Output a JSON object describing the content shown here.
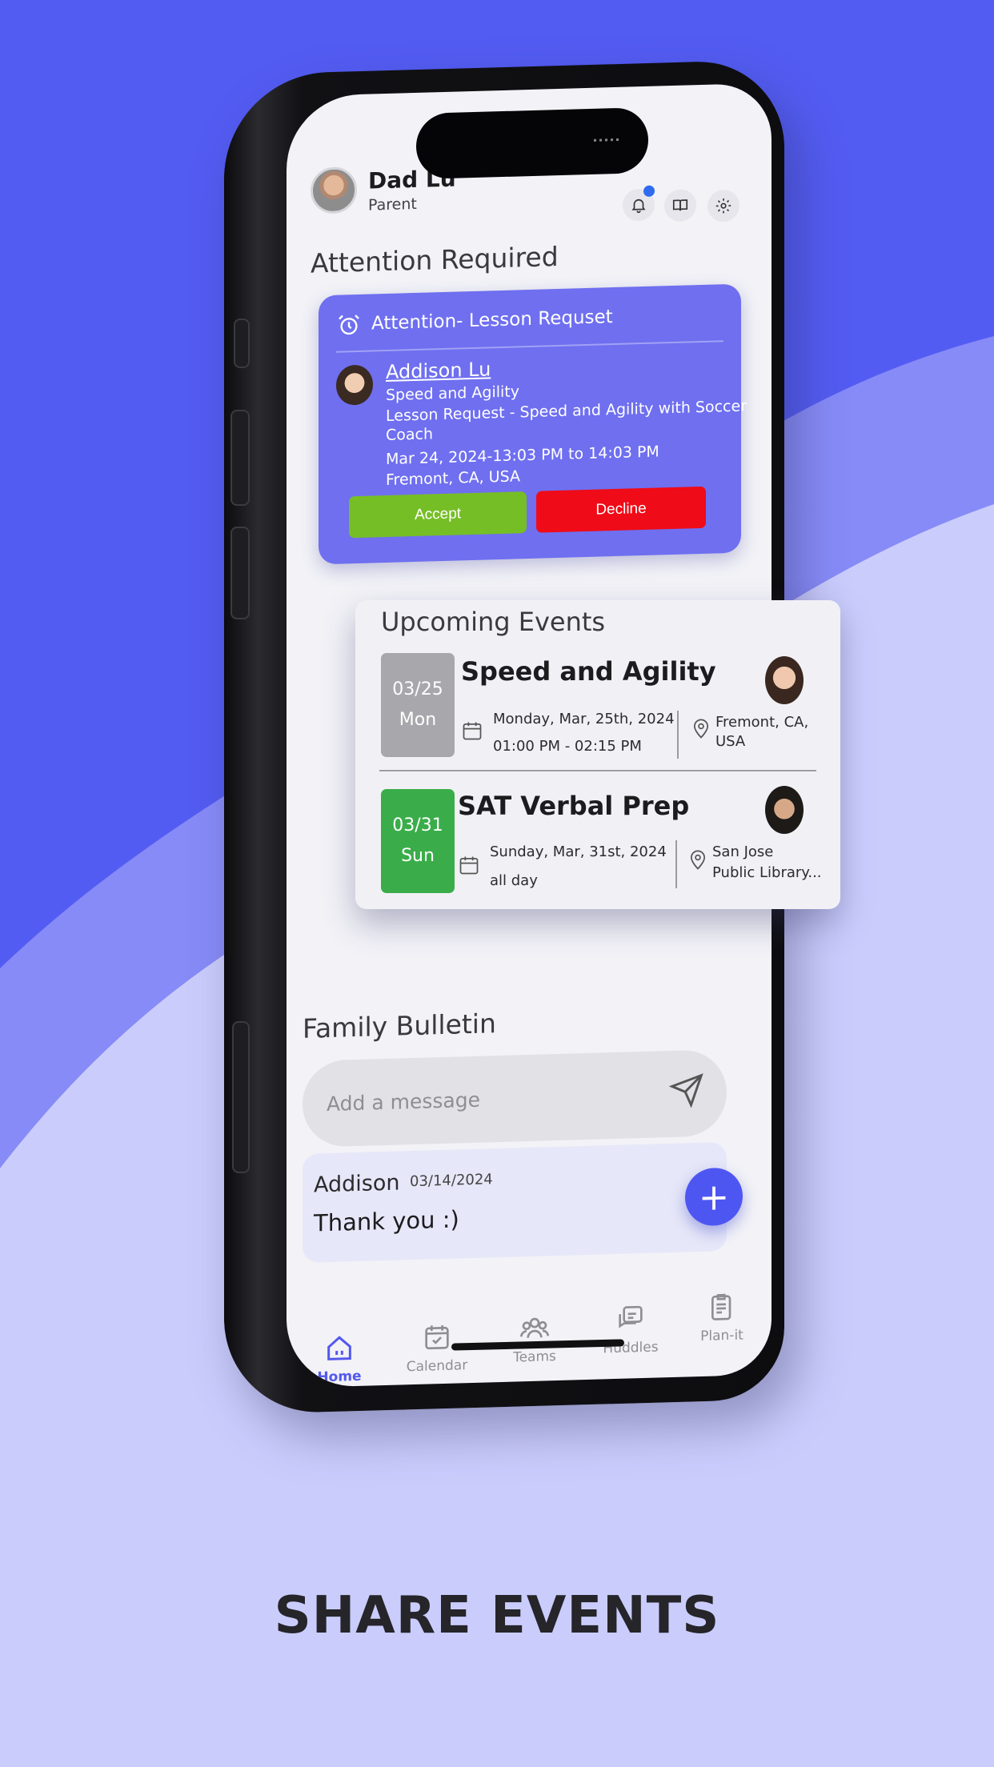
{
  "colors": {
    "accent": "#5258ee",
    "attention_card": "#6f6ff0",
    "accept": "#76be26",
    "decline": "#ef0b17",
    "event_gray": "#a8a8ac",
    "event_green": "#3aad4a"
  },
  "header": {
    "user_name": "Dad Lu",
    "user_role": "Parent",
    "icons": [
      "bell-icon",
      "book-icon",
      "gear-icon"
    ]
  },
  "attention": {
    "section_title": "Attention Required",
    "card_title": "Attention- Lesson Requset",
    "person": "Addison Lu",
    "activity": "Speed and Agility",
    "request_line1": "Lesson Request - Speed and Agility with Soccer",
    "request_line2": "Coach",
    "datetime": "Mar 24, 2024-13:03 PM to 14:03 PM",
    "location": "Fremont, CA, USA",
    "accept_label": "Accept",
    "decline_label": "Decline"
  },
  "events": {
    "section_title": "Upcoming Events",
    "items": [
      {
        "date": "03/25",
        "day": "Mon",
        "name": "Speed and Agility",
        "date_long": "Monday, Mar, 25th, 2024",
        "time": "01:00 PM - 02:15 PM",
        "location_line1": "Fremont, CA,",
        "location_line2": "USA"
      },
      {
        "date": "03/31",
        "day": "Sun",
        "name": "SAT Verbal Prep",
        "date_long": "Sunday, Mar, 31st, 2024",
        "time": "all day",
        "location_line1": "San Jose",
        "location_line2": "Public Library..."
      }
    ]
  },
  "bulletin": {
    "section_title": "Family Bulletin",
    "input_placeholder": "Add a message",
    "items": [
      {
        "author": "Addison",
        "date": "03/14/2024",
        "message": "Thank you :)"
      }
    ],
    "fab_label": "+"
  },
  "tabs": [
    {
      "label": "Home",
      "icon": "home-icon"
    },
    {
      "label": "Calendar",
      "icon": "calendar-icon"
    },
    {
      "label": "Teams",
      "icon": "teams-icon"
    },
    {
      "label": "Huddles",
      "icon": "huddles-icon"
    },
    {
      "label": "Plan-it",
      "icon": "plan-it-icon"
    }
  ],
  "headline": "SHARE EVENTS"
}
